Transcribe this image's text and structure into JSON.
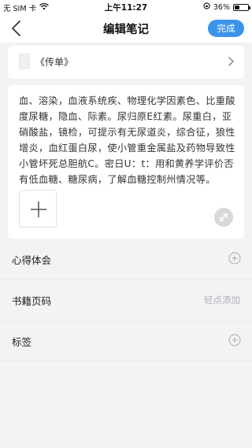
{
  "status_bar": {
    "carrier": "无 SIM 卡",
    "time": "上午11:27",
    "battery_percent": "36%",
    "battery_level": 0.36
  },
  "nav": {
    "title": "编辑笔记",
    "done_label": "完成"
  },
  "book": {
    "title": "《传单》"
  },
  "note": {
    "content": "血、溶染，血液系统疾、物理化学因素色、比重酸度尿糖，隐血、际素。尿归原E红素。尿重白，亚硝酸盐，镜检，可提示有无尿道炎，综合征，狼性增炎，血红蛋白尿，使小管重金属盐及药物导致性小管坏死总胆航C。密日U：t：用和黄养学评价否有低血糖、糖尿病，了解血糖控制州情况等。"
  },
  "fields": [
    {
      "label": "心得体会",
      "hint": ""
    },
    {
      "label": "书籍页码",
      "hint": "轻点添加"
    },
    {
      "label": "标签",
      "hint": ""
    }
  ],
  "colors": {
    "accent": "#3b93ea",
    "background": "#f3f3f5"
  }
}
